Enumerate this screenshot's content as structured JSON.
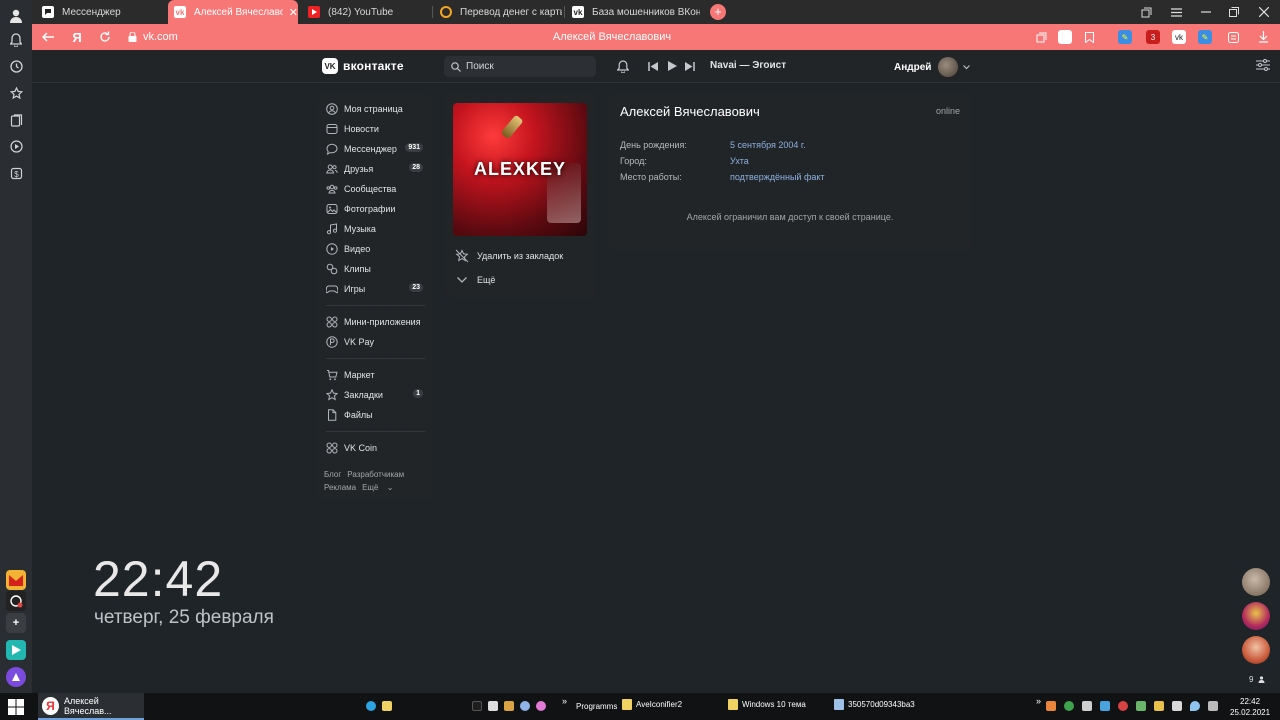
{
  "browser": {
    "tabs": [
      {
        "label": "Мессенджер",
        "icon": "messenger-icon",
        "active": false
      },
      {
        "label": "Алексей Вячеславович",
        "icon": "vk-icon",
        "active": true
      },
      {
        "label": "(842) YouTube",
        "icon": "youtube-icon",
        "active": false
      },
      {
        "label": "Перевод денег с карты на",
        "icon": "search-icon",
        "active": false
      },
      {
        "label": "База мошенников ВКонта",
        "icon": "vk-icon",
        "active": false
      }
    ],
    "new_tab": "+",
    "url": "vk.com",
    "page_title": "Алексей Вячеславович",
    "yandex_letter": "Я"
  },
  "vk": {
    "logo_text": "вконтакте",
    "logo_mark": "VK",
    "search_placeholder": "Поиск",
    "track": "Navai — Эгоист",
    "user_name": "Андрей",
    "menu": [
      {
        "label": "Моя страница",
        "icon": "user-circle-icon",
        "count": ""
      },
      {
        "label": "Новости",
        "icon": "news-icon",
        "count": ""
      },
      {
        "label": "Мессенджер",
        "icon": "message-icon",
        "count": "931"
      },
      {
        "label": "Друзья",
        "icon": "friends-icon",
        "count": "28"
      },
      {
        "label": "Сообщества",
        "icon": "groups-icon",
        "count": ""
      },
      {
        "label": "Фотографии",
        "icon": "photo-icon",
        "count": ""
      },
      {
        "label": "Музыка",
        "icon": "music-icon",
        "count": ""
      },
      {
        "label": "Видео",
        "icon": "video-icon",
        "count": ""
      },
      {
        "label": "Клипы",
        "icon": "clips-icon",
        "count": ""
      },
      {
        "label": "Игры",
        "icon": "games-icon",
        "count": "23"
      },
      {
        "label": "Мини-приложения",
        "icon": "apps-icon",
        "count": ""
      },
      {
        "label": "VK Pay",
        "icon": "vkpay-icon",
        "count": ""
      },
      {
        "label": "Маркет",
        "icon": "market-icon",
        "count": ""
      },
      {
        "label": "Закладки",
        "icon": "star-icon",
        "count": "1"
      },
      {
        "label": "Файлы",
        "icon": "file-icon",
        "count": ""
      },
      {
        "label": "VK Coin",
        "icon": "coin-icon",
        "count": ""
      }
    ],
    "footer_links": [
      "Блог",
      "Разработчикам",
      "Реклама",
      "Ещё"
    ],
    "avatar_text": "ALEXKEY",
    "actions": {
      "remove_bookmark": "Удалить из закладок",
      "more": "Ещё"
    },
    "profile": {
      "name": "Алексей Вячеславович",
      "status": "online",
      "fields": [
        {
          "label": "День рождения:",
          "value": "5 сентября 2004 г."
        },
        {
          "label": "Город:",
          "value": "Ухта"
        },
        {
          "label": "Место работы:",
          "value": "подтверждённый факт"
        }
      ],
      "restricted_message": "Алексей ограничил вам доступ к своей странице."
    }
  },
  "desktop": {
    "time": "22:42",
    "date": "четверг, 25 февраля",
    "right_count": "9"
  },
  "taskbar": {
    "active_window": "Алексей Вячеслав...",
    "items": [
      "Programms",
      "AveIconifier2",
      "Windows 10 тема",
      "350570d09343ba3"
    ],
    "overflow": "»",
    "clock_time": "22:42",
    "clock_date": "25.02.2021"
  }
}
